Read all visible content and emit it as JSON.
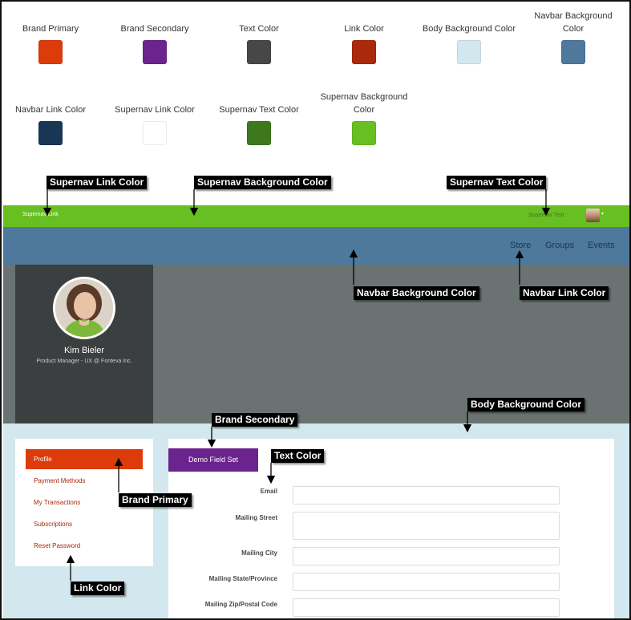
{
  "palette": [
    {
      "label": "Brand Primary",
      "color": "#dd3b0a"
    },
    {
      "label": "Brand Secondary",
      "color": "#6b248e"
    },
    {
      "label": "Text Color",
      "color": "#474747"
    },
    {
      "label": "Link Color",
      "color": "#a9290a"
    },
    {
      "label": "Body Background Color",
      "color": "#d3e8ee"
    },
    {
      "label": "Navbar Background Color",
      "color": "#4e789c"
    },
    {
      "label": "Navbar Link Color",
      "color": "#193654"
    },
    {
      "label": "Supernav Link Color",
      "color": "#ffffff"
    },
    {
      "label": "Supernav Text Color",
      "color": "#3d781d"
    },
    {
      "label": "Supernav Background Color",
      "color": "#67bf21"
    }
  ],
  "supernav": {
    "link": "Supernav Link",
    "text": "Supernav Text",
    "caret": "▾"
  },
  "navbar": {
    "links": [
      "Store",
      "Groups",
      "Events"
    ]
  },
  "profile": {
    "name": "Kim Bieler",
    "title": "Product Manager - UX @ Fonteva Inc."
  },
  "side_menu": {
    "items": [
      "Profile",
      "Payment Methods",
      "My Transactions",
      "Subscriptions",
      "Reset Password"
    ],
    "active": "Profile"
  },
  "form": {
    "fieldset_tab": "Demo Field Set",
    "fields": [
      "Email",
      "Mailing Street",
      "Mailing City",
      "Mailing State/Province",
      "Mailing Zip/Postal Code"
    ]
  },
  "annotations": {
    "supernav_link": "Supernav Link Color",
    "supernav_background": "Supernav Background Color",
    "supernav_text": "Supernav Text Color",
    "navbar_background": "Navbar Background Color",
    "navbar_link": "Navbar Link Color",
    "body_background": "Body Background Color",
    "brand_secondary": "Brand Secondary",
    "text_color": "Text Color",
    "brand_primary": "Brand Primary",
    "link_color": "Link Color"
  }
}
